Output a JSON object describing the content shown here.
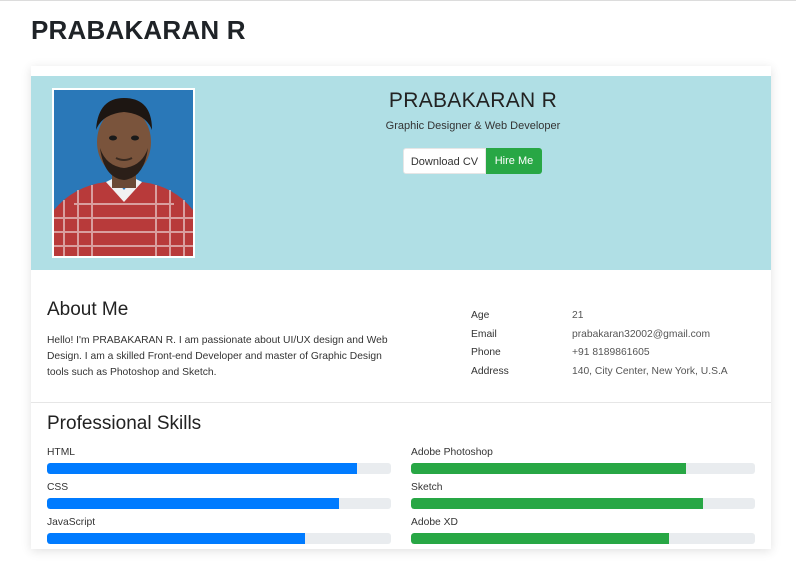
{
  "page": {
    "title": "PRABAKARAN R"
  },
  "profile": {
    "name": "PRABAKARAN R",
    "title": "Graphic Designer & Web Developer",
    "buttons": {
      "download_cv": "Download CV",
      "hire_me": "Hire Me"
    }
  },
  "about": {
    "heading": "About Me",
    "text": "Hello! I'm PRABAKARAN R. I am passionate about UI/UX design and Web Design. I am a skilled Front-end Developer and master of Graphic Design tools such as Photoshop and Sketch.",
    "info": [
      {
        "key": "Age",
        "value": "21"
      },
      {
        "key": "Email",
        "value": "prabakaran32002@gmail.com"
      },
      {
        "key": "Phone",
        "value": "+91 8189861605"
      },
      {
        "key": "Address",
        "value": "140, City Center, New York, U.S.A"
      }
    ]
  },
  "skills": {
    "heading": "Professional Skills",
    "left": [
      {
        "name": "HTML",
        "level": 90,
        "color": "#007bff"
      },
      {
        "name": "CSS",
        "level": 85,
        "color": "#007bff"
      },
      {
        "name": "JavaScript",
        "level": 75,
        "color": "#007bff"
      }
    ],
    "right": [
      {
        "name": "Adobe Photoshop",
        "level": 80,
        "color": "#28a745"
      },
      {
        "name": "Sketch",
        "level": 85,
        "color": "#28a745"
      },
      {
        "name": "Adobe XD",
        "level": 75,
        "color": "#28a745"
      }
    ]
  },
  "colors": {
    "header_bg": "#b0dfe5",
    "primary": "#007bff",
    "success": "#28a745"
  }
}
